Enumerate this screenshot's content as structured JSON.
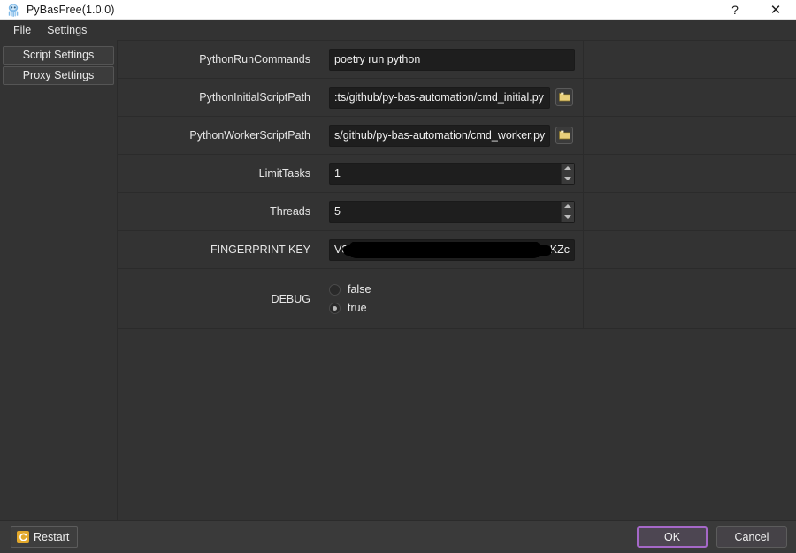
{
  "window": {
    "title": "PyBasFree(1.0.0)",
    "app_icon": "squid-app-icon",
    "help_label": "?",
    "close_label": "✕"
  },
  "menubar": {
    "items": [
      {
        "label": "File"
      },
      {
        "label": "Settings"
      }
    ]
  },
  "sidebar": {
    "items": [
      {
        "label": "Script Settings",
        "name": "script-settings"
      },
      {
        "label": "Proxy Settings",
        "name": "proxy-settings"
      }
    ]
  },
  "form": {
    "rows": [
      {
        "label": "PythonRunCommands",
        "type": "text",
        "value": "poetry run python",
        "placeholder": ""
      },
      {
        "label": "PythonInitialScriptPath",
        "type": "text-browse",
        "value": ":ts/github/py-bas-automation/cmd_initial.py",
        "placeholder": "",
        "browse_icon": "folder-icon"
      },
      {
        "label": "PythonWorkerScriptPath",
        "type": "text-browse",
        "value": "s/github/py-bas-automation/cmd_worker.py",
        "placeholder": "",
        "browse_icon": "folder-icon"
      },
      {
        "label": "LimitTasks",
        "type": "spin",
        "value": "1",
        "placeholder": ""
      },
      {
        "label": "Threads",
        "type": "spin",
        "value": "5",
        "placeholder": ""
      },
      {
        "label": "FINGERPRINT KEY",
        "type": "text-redacted",
        "value": "V34…KZc",
        "value_prefix": "V34",
        "value_suffix": "KZc",
        "placeholder": ""
      },
      {
        "label": "DEBUG",
        "type": "radio",
        "options": [
          {
            "label": "false",
            "selected": false
          },
          {
            "label": "true",
            "selected": true
          }
        ]
      }
    ]
  },
  "footer": {
    "restart_label": "Restart",
    "restart_icon": "refresh-icon",
    "ok_label": "OK",
    "cancel_label": "Cancel"
  },
  "colors": {
    "window_bg": "#333333",
    "titlebar_bg": "#ffffff",
    "input_bg": "#1e1e1e",
    "divider": "#2b2b2b",
    "accent_default_button": "#a568c8",
    "restart_icon": "#e3a82a",
    "folder_icon": "#e8cf7a"
  }
}
